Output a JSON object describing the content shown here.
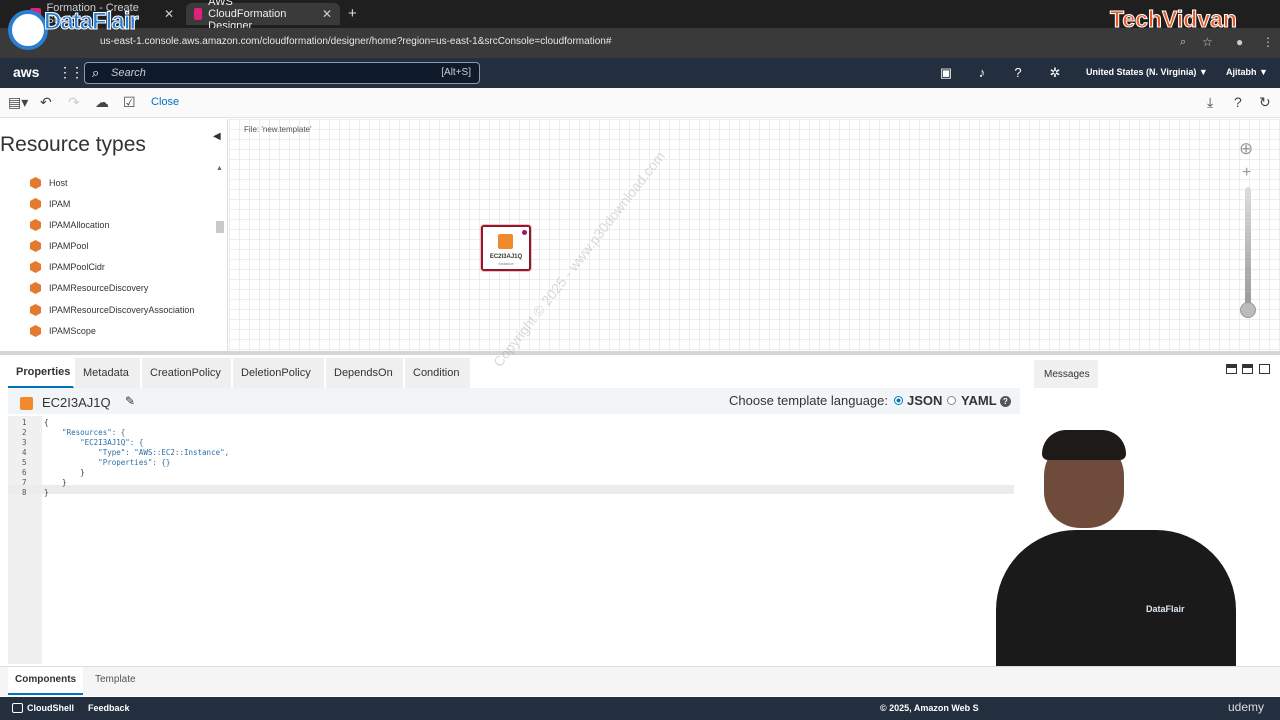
{
  "browser": {
    "tabs": [
      {
        "label": "Formation - Create Stack"
      },
      {
        "label": "AWS CloudFormation Designer"
      }
    ],
    "new_tab": "+",
    "url": "us-east-1.console.aws.amazon.com/cloudformation/designer/home?region=us-east-1&srcConsole=cloudformation#"
  },
  "overlays": {
    "left_logo": "DataFlair",
    "right_logo": "TechVidvan",
    "watermark": "Copyright © 2025 - www.p30download.com",
    "udemy": "udemy"
  },
  "awsnav": {
    "logo": "aws",
    "search_placeholder": "Search",
    "search_shortcut": "[Alt+S]",
    "region": "United States (N. Virginia) ▼",
    "user": "Ajitabh ▼"
  },
  "toolbar": {
    "close_label": "Close"
  },
  "resource_types": {
    "title": "Resource types",
    "items": [
      "Host",
      "IPAM",
      "IPAMAllocation",
      "IPAMPool",
      "IPAMPoolCidr",
      "IPAMResourceDiscovery",
      "IPAMResourceDiscoveryAssociation",
      "IPAMScope"
    ]
  },
  "canvas": {
    "file_label": "File: 'new.template'",
    "node_name": "EC2I3AJ1Q",
    "node_type": "Instance"
  },
  "properties": {
    "tabs": [
      "Properties",
      "Metadata",
      "CreationPolicy",
      "DeletionPolicy",
      "DependsOn",
      "Condition"
    ],
    "resource_name": "EC2I3AJ1Q",
    "template_language_label": "Choose template language:",
    "json_label": "JSON",
    "yaml_label": "YAML",
    "code_lines": [
      "{",
      "    \"Resources\": {",
      "        \"EC2I3AJ1Q\": {",
      "            \"Type\": \"AWS::EC2::Instance\",",
      "            \"Properties\": {}",
      "        }",
      "    }",
      "}"
    ],
    "line_numbers": [
      "1",
      "2",
      "3",
      "4",
      "5",
      "6",
      "7",
      "8"
    ]
  },
  "messages": {
    "title": "Messages"
  },
  "bottom_tabs": [
    "Components",
    "Template"
  ],
  "footer": {
    "cloudshell": "CloudShell",
    "feedback": "Feedback",
    "copyright": "© 2025, Amazon Web S"
  },
  "colors": {
    "aws_nav": "#232f3e",
    "accent": "#0073bb",
    "resource_orange": "#e57a2e",
    "tab_pink": "#e0217a"
  }
}
